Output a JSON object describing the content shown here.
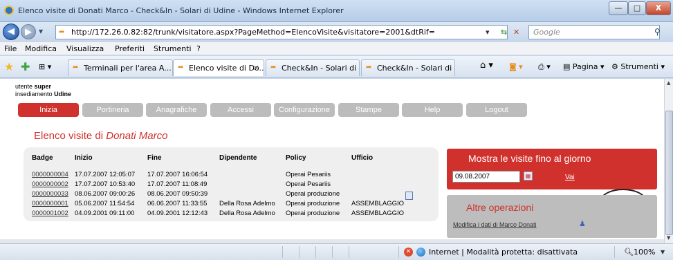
{
  "window": {
    "title": "Elenco visite di Donati Marco - Check&In - Solari di Udine - Windows Internet Explorer",
    "btn_min": "—",
    "btn_max": "□",
    "btn_close": "X"
  },
  "addressbar": {
    "url": "http://172.26.0.82:82/trunk/visitatore.aspx?PageMethod=ElencoVisite&visitatore=2001&dtRif=",
    "search_placeholder": "Google"
  },
  "menu": [
    "File",
    "Modifica",
    "Visualizza",
    "Preferiti",
    "Strumenti",
    "?"
  ],
  "tabs": [
    {
      "label": "Terminali per l'area A..."
    },
    {
      "label": "Elenco visite di Do..."
    },
    {
      "label": "Check&In - Solari di ..."
    },
    {
      "label": "Check&In - Solari di ..."
    }
  ],
  "commandbar": {
    "page": "Pagina",
    "tools": "Strumenti"
  },
  "user": {
    "utente_label": "utente",
    "utente_value": "super",
    "insediamento_label": "insediamento",
    "insediamento_value": "Udine"
  },
  "nav": [
    "Inizia",
    "Portineria",
    "Anagrafiche",
    "Accessi",
    "Configurazione",
    "Stampe",
    "Help",
    "Logout"
  ],
  "page_title": {
    "prefix": "Elenco visite di",
    "name": "Donati Marco"
  },
  "visits": {
    "columns": [
      "Badge",
      "Inizio",
      "Fine",
      "Dipendente",
      "Policy",
      "Ufficio"
    ],
    "rows": [
      {
        "badge": "0000000004",
        "inizio": "17.07.2007 12:05:07",
        "fine": "17.07.2007 16:06:54",
        "dipendente": "",
        "policy": "Operai Pesariis",
        "ufficio": ""
      },
      {
        "badge": "0000000002",
        "inizio": "17.07.2007 10:53:40",
        "fine": "17.07.2007 11:08:49",
        "dipendente": "",
        "policy": "Operai Pesariis",
        "ufficio": ""
      },
      {
        "badge": "0000000033",
        "inizio": "08.06.2007 09:00:26",
        "fine": "08.06.2007 09:50:39",
        "dipendente": "",
        "policy": "Operai produzione",
        "ufficio": ""
      },
      {
        "badge": "0000000001",
        "inizio": "05.06.2007 11:54:54",
        "fine": "06.06.2007 11:33:55",
        "dipendente": "Della Rosa Adelmo",
        "policy": "Operai produzione",
        "ufficio": "ASSEMBLAGGIO"
      },
      {
        "badge": "0000001002",
        "inizio": "04.09.2001 09:11:00",
        "fine": "04.09.2001 12:12:43",
        "dipendente": "Della Rosa Adelmo",
        "policy": "Operai produzione",
        "ufficio": "ASSEMBLAGGIO"
      }
    ]
  },
  "show_until": {
    "title": "Mostra le visite fino al giorno",
    "date_value": "09.08.2007",
    "go_label": "Vai"
  },
  "other_ops": {
    "title": "Altre operazioni",
    "link": "Modifica i dati di Marco Donati"
  },
  "status": {
    "zone": "Internet | Modalità protetta: disattivata",
    "zoom": "100%"
  },
  "colors": {
    "accent": "#d0312d",
    "nav_inactive": "#bcbcbc",
    "panel_bg": "#efefef"
  }
}
